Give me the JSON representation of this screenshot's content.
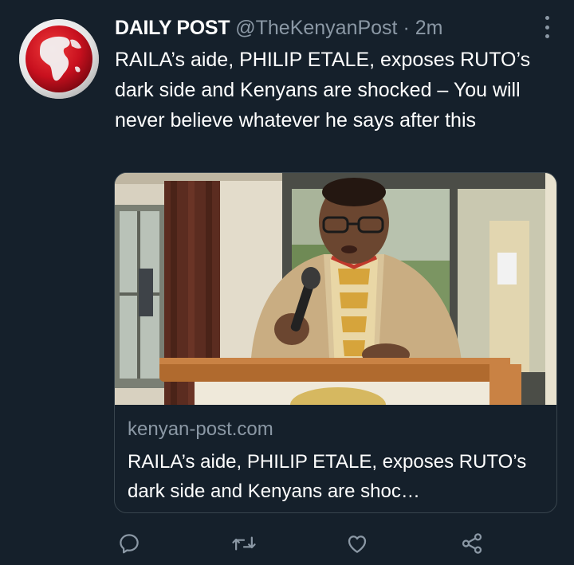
{
  "tweet": {
    "author_name": "DAILY POST",
    "handle": "@TheKenyanPost",
    "separator": "·",
    "time": "2m",
    "text": "RAILA’s aide, PHILIP ETALE, exposes RUTO’s dark side and Kenyans are shocked – You will never believe whatever he says after this"
  },
  "card": {
    "domain": "kenyan-post.com",
    "title": "RAILA’s aide, PHILIP ETALE, exposes RUTO’s dark side and Kenyans are shoc…"
  },
  "actions": {
    "reply_icon": "reply-icon",
    "retweet_icon": "retweet-icon",
    "like_icon": "like-icon",
    "share_icon": "share-icon"
  },
  "colors": {
    "background": "#15202b",
    "secondary_text": "#8b98a5",
    "border": "#38444d",
    "logo_red": "#c8101e"
  }
}
